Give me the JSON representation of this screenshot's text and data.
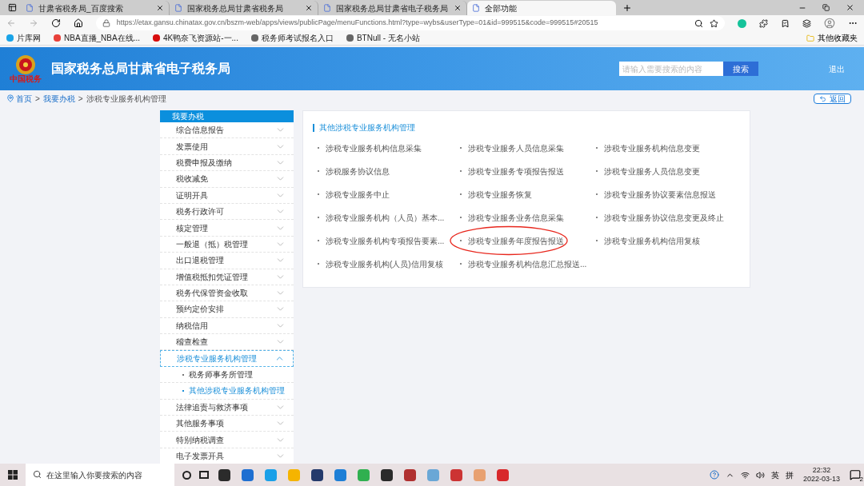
{
  "browser": {
    "tabs": [
      {
        "title": "甘肃省税务局_百度搜索",
        "selected": false
      },
      {
        "title": "国家税务总局甘肃省税务局",
        "selected": false
      },
      {
        "title": "国家税务总局甘肃省电子税务局",
        "selected": false
      },
      {
        "title": "全部功能",
        "selected": true
      }
    ],
    "url": "https://etax.gansu.chinatax.gov.cn/bszm-web/apps/views/publicPage/menuFunctions.html?type=wybs&userType=01&id=999515&code=999515#20515",
    "bookmarks": [
      "片库网",
      "NBA直播_NBA在线...",
      "4K鸭奈飞资源站-一...",
      "税务师考试报名入口",
      "BTNull - 无名小站"
    ],
    "other_bookmarks": "其他收藏夹"
  },
  "header": {
    "emblem_text": "中国税务",
    "title": "国家税务总局甘肃省电子税务局",
    "search": {
      "placeholder": "请输入需要搜索的内容"
    },
    "search_button": "搜索",
    "logout": "退出"
  },
  "breadcrumb": [
    {
      "kind": "link",
      "text": "首页"
    },
    {
      "kind": "separator",
      "text": ">"
    },
    {
      "kind": "link",
      "text": "我要办税"
    },
    {
      "kind": "separator",
      "text": ">"
    },
    {
      "kind": "current",
      "text": "涉税专业服务机构管理"
    }
  ],
  "back_button": "返回",
  "sidebar": {
    "title": "我要办税",
    "items": [
      {
        "label": "综合信息报告",
        "expanded": false
      },
      {
        "label": "发票使用",
        "expanded": false
      },
      {
        "label": "税费申报及缴纳",
        "expanded": false
      },
      {
        "label": "税收减免",
        "expanded": false
      },
      {
        "label": "证明开具",
        "expanded": false
      },
      {
        "label": "税务行政许可",
        "expanded": false
      },
      {
        "label": "核定管理",
        "expanded": false
      },
      {
        "label": "一般退（抵）税管理",
        "expanded": false
      },
      {
        "label": "出口退税管理",
        "expanded": false
      },
      {
        "label": "增值税抵扣凭证管理",
        "expanded": false
      },
      {
        "label": "税务代保管资金收取",
        "expanded": false
      },
      {
        "label": "预约定价安排",
        "expanded": false
      },
      {
        "label": "纳税信用",
        "expanded": false
      },
      {
        "label": "稽查检查",
        "expanded": false
      },
      {
        "label": "涉税专业服务机构管理",
        "expanded": true,
        "children": [
          {
            "label": "税务师事务所管理",
            "selected": false
          },
          {
            "label": "其他涉税专业服务机构管理",
            "selected": true
          }
        ]
      },
      {
        "label": "法律追责与救济事项",
        "expanded": false
      },
      {
        "label": "其他服务事项",
        "expanded": false
      },
      {
        "label": "特别纳税调查",
        "expanded": false
      },
      {
        "label": "电子发票开具",
        "expanded": false
      }
    ]
  },
  "panel": {
    "title": "其他涉税专业服务机构管理",
    "items": [
      {
        "label": "涉税专业服务机构信息采集",
        "circled": false
      },
      {
        "label": "涉税专业服务人员信息采集",
        "circled": false
      },
      {
        "label": "涉税专业服务机构信息变更",
        "circled": false
      },
      {
        "label": "涉税服务协议信息",
        "circled": false
      },
      {
        "label": "涉税专业服务专项报告报送",
        "circled": false
      },
      {
        "label": "涉税专业服务人员信息变更",
        "circled": false
      },
      {
        "label": "涉税专业服务中止",
        "circled": false
      },
      {
        "label": "涉税专业服务恢复",
        "circled": false
      },
      {
        "label": "涉税专业服务协议要素信息报送",
        "circled": false
      },
      {
        "label": "涉税专业服务机构（人员）基本...",
        "circled": false
      },
      {
        "label": "涉税专业服务业务信息采集",
        "circled": false
      },
      {
        "label": "涉税专业服务协议信息变更及终止",
        "circled": false
      },
      {
        "label": "涉税专业服务机构专项报告要素...",
        "circled": false
      },
      {
        "label": "涉税专业服务年度报告报送",
        "circled": true
      },
      {
        "label": "涉税专业服务机构信用复核",
        "circled": false
      },
      {
        "label": "涉税专业服务机构(人员)信用复核",
        "circled": false
      },
      {
        "label": "涉税专业服务机构信息汇总报送...",
        "circled": false
      }
    ]
  },
  "taskbar": {
    "search": {
      "placeholder": "在这里输入你要搜索的内容"
    },
    "ime_language": "英",
    "ime_mode": "拼",
    "time": "22:32",
    "date": "2022-03-13",
    "notifications": "2"
  }
}
